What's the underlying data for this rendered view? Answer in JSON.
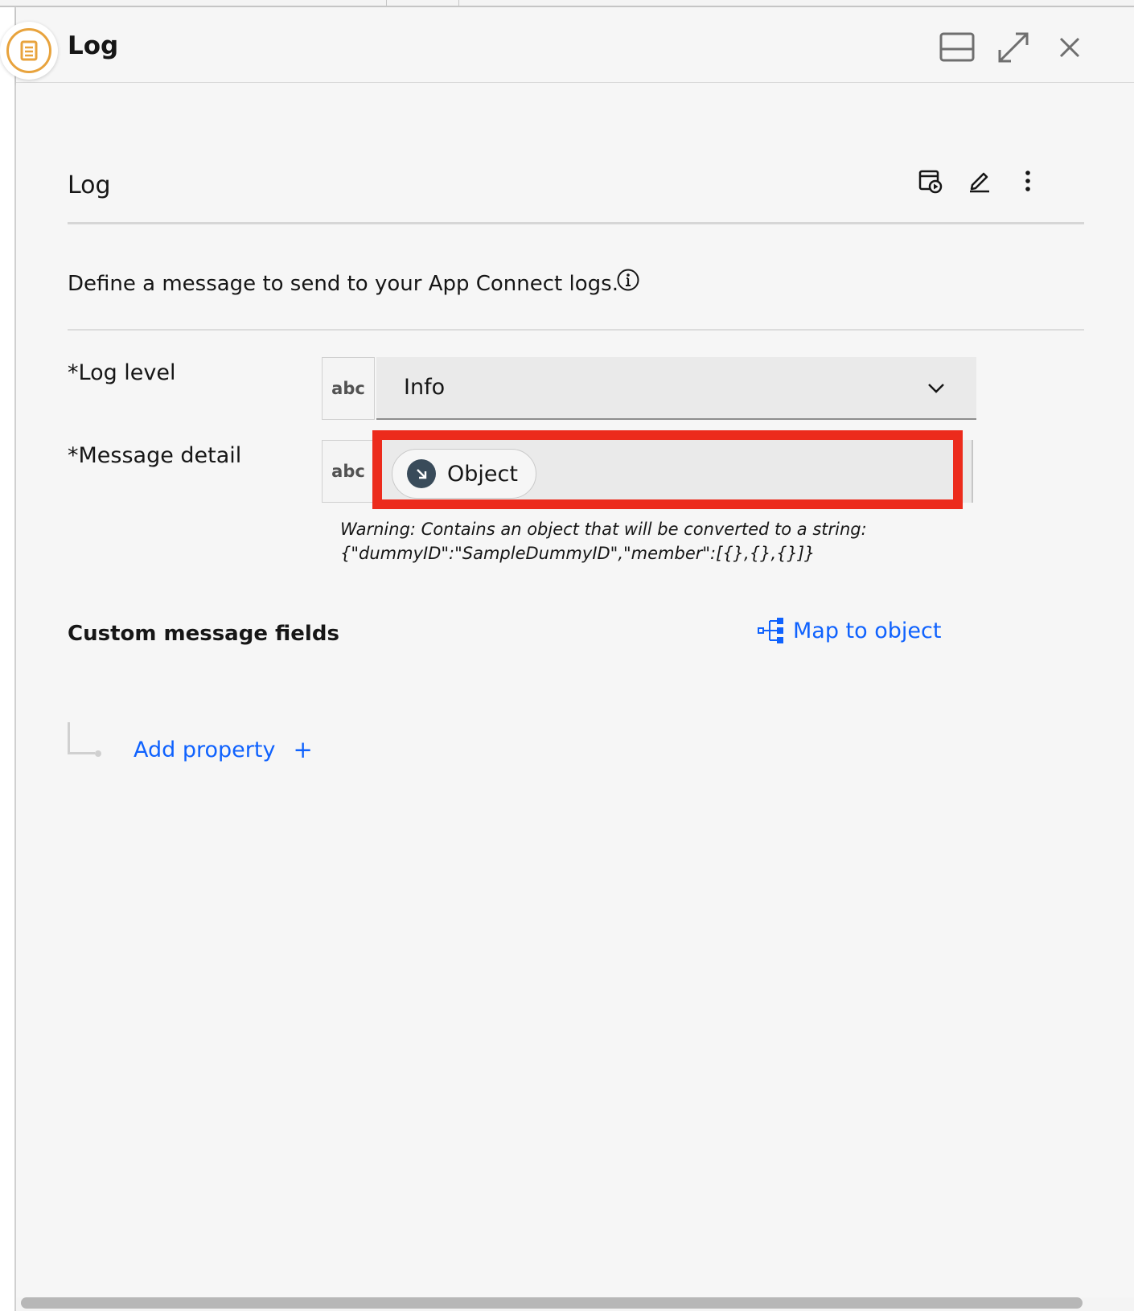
{
  "header": {
    "title": "Log",
    "app_icon": "log-document-icon",
    "actions": [
      "split-panel-icon",
      "maximize-icon",
      "close-icon"
    ]
  },
  "section": {
    "title": "Log",
    "actions": [
      "test-run-icon",
      "edit-icon",
      "overflow-menu-icon"
    ]
  },
  "description": "Define a message to send to your App Connect logs.",
  "fields": {
    "log_level": {
      "label": "*Log level",
      "type_badge": "abc",
      "value": "Info"
    },
    "message_detail": {
      "label": "*Message detail",
      "type_badge": "abc",
      "token": "Object",
      "warning_line1": "Warning: Contains an object that will be converted to a string:",
      "warning_line2": "{\"dummyID\":\"SampleDummyID\",\"member\":[{},{},{}]}"
    }
  },
  "custom_fields": {
    "title": "Custom message fields",
    "map_link": "Map to object",
    "add_property": "Add property",
    "add_symbol": "+"
  },
  "colors": {
    "accent": "#0f62fe",
    "highlight": "#ec2b1c",
    "app_icon": "#e8a33d"
  }
}
